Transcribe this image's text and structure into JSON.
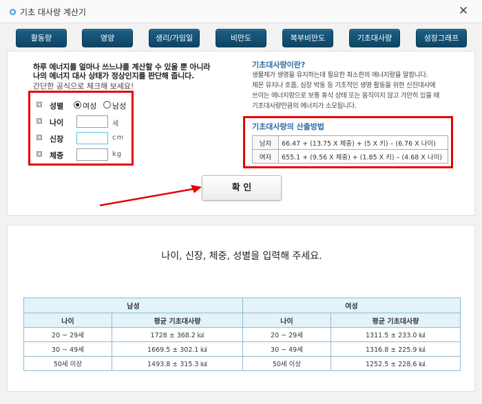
{
  "window": {
    "title": "기초 대사량 계산기",
    "close": "✕"
  },
  "tabs": [
    "활동량",
    "영양",
    "생리/가임일",
    "비만도",
    "복부비만도",
    "기초대사량",
    "성장그래프"
  ],
  "intro": {
    "line1": "하루 에너지를 얼마나 쓰느냐를 계산할 수 있을 뿐 아니라",
    "line2": "나의 에너지 대사 상태가 정상인지를 판단해 줍니다.",
    "sub": "간단한 공식으로 체크해 보세요!"
  },
  "form": {
    "gender_label": "성별",
    "gender_female": "여성",
    "gender_male": "남성",
    "age_label": "나이",
    "age_unit": "세",
    "height_label": "신장",
    "height_unit": "cm",
    "weight_label": "체중",
    "weight_unit": "kg"
  },
  "confirm_label": "확 인",
  "info": {
    "title": "기초대사량이란?",
    "line1": "생물체가 생명을 유지하는데 필요한 최소한의 에너지량을 말합니다.",
    "line2": "체온 유지나 호흡, 심장 박동 등 기초적인 생명 활동을 위한 신진대사에",
    "line3": "쓰이는 에너지량으로 보통 휴식 상태 또는 움직이지 않고 가만히 있을 때",
    "line4": "기초대사량만큼의 에너지가 소모됩니다."
  },
  "formula": {
    "title": "기초대사량의 산출방법",
    "rows": [
      {
        "label": "남자",
        "text": "66.47 + (13.75 X 체중) + (5 X 키) – (6.76 X 나이)"
      },
      {
        "label": "여자",
        "text": "655.1 + (9.56 X 체중) + (1.85 X 키) – (4.68 X 나이)"
      }
    ]
  },
  "message": "나이, 신장, 체중, 성별을 입력해 주세요.",
  "bmr_table": {
    "male_header": "남성",
    "female_header": "여성",
    "col_age": "나이",
    "col_avg": "평균 기초대사량",
    "rows": [
      {
        "m_age": "20 ~ 29세",
        "m_val": "1728 ± 368.2 ㎉",
        "f_age": "20 ~ 29세",
        "f_val": "1311.5 ± 233.0 ㎉"
      },
      {
        "m_age": "30 ~ 49세",
        "m_val": "1669.5 ± 302.1 ㎉",
        "f_age": "30 ~ 49세",
        "f_val": "1316.8 ± 225.9 ㎉"
      },
      {
        "m_age": "50세 이상",
        "m_val": "1493.8 ± 315.3 ㎉",
        "f_age": "50세 이상",
        "f_val": "1252.5 ± 228.6 ㎉"
      }
    ]
  },
  "colors": {
    "tab_bg": "#14506f",
    "highlight_border": "#e60000",
    "accent_blue": "#2b6ca3",
    "table_header": "#e3f3f9"
  }
}
